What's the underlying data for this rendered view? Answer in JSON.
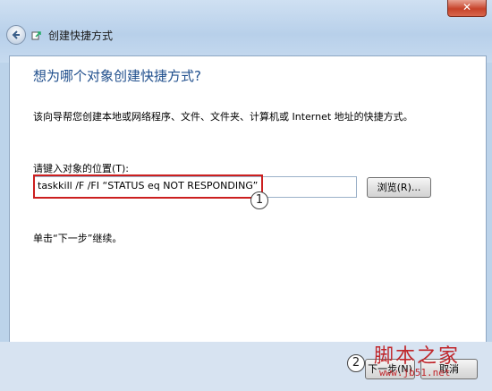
{
  "window": {
    "title": "创建快捷方式",
    "close_label": "✕"
  },
  "main": {
    "heading": "想为哪个对象创建快捷方式?",
    "description": "该向导帮您创建本地或网络程序、文件、文件夹、计算机或 Internet 地址的快捷方式。",
    "location_label": "请键入对象的位置(T):",
    "location_value": "taskkill /F /FI “STATUS eq NOT RESPONDING”",
    "browse_label": "浏览(R)...",
    "hint": "单击“下一步”继续。",
    "callout_1": "1",
    "callout_2": "2"
  },
  "footer": {
    "next_label": "下一步(N)",
    "cancel_label": "取消"
  },
  "watermark": {
    "text": "脚本之家",
    "url": "www.jb51.net"
  },
  "colors": {
    "heading": "#1f4e8c",
    "highlight_box": "#cc1f1f",
    "watermark": "#c0262b"
  }
}
